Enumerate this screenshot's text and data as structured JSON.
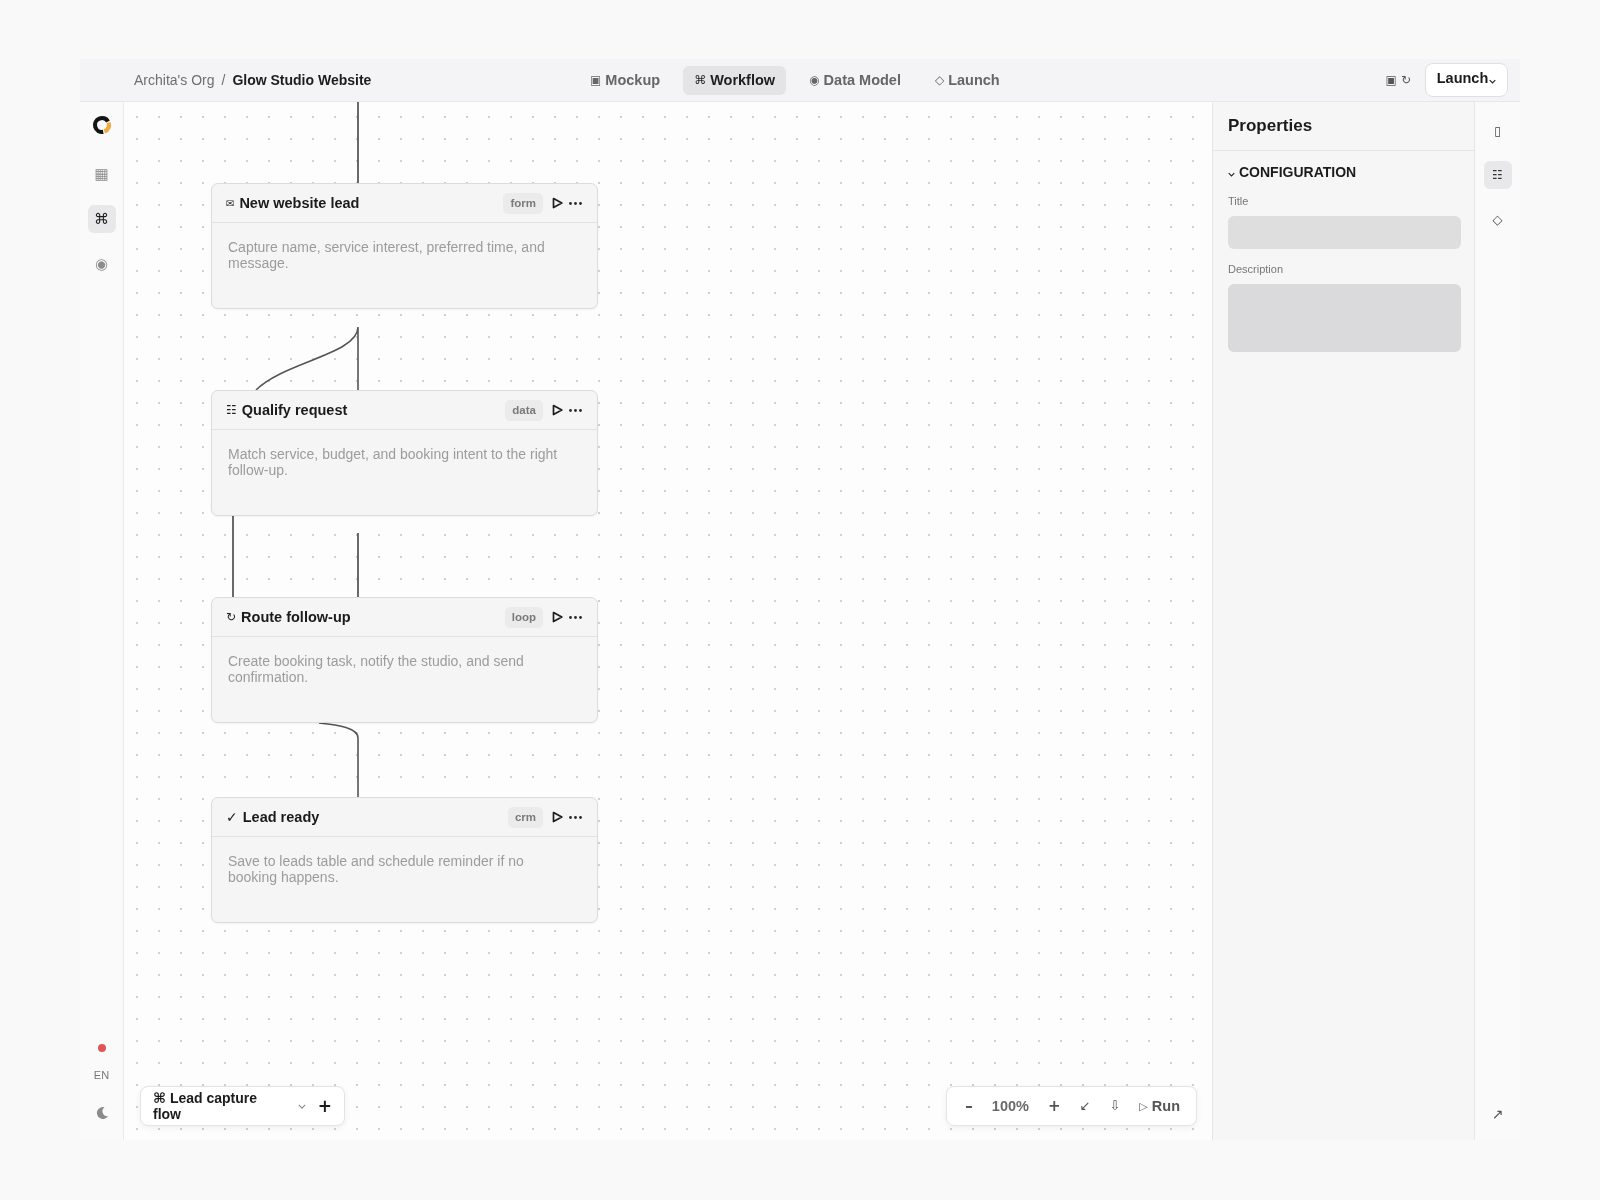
{
  "header": {
    "breadcrumb": {
      "org": "Archita's Org",
      "separator": "/",
      "project": "Glow Studio Website"
    },
    "tabs": [
      {
        "icon": "▣",
        "label": "Mockup",
        "selected": false
      },
      {
        "icon": "⌘",
        "label": "Workflow",
        "selected": true
      },
      {
        "icon": "◉",
        "label": "Data Model",
        "selected": false
      },
      {
        "icon": "◇",
        "label": "Launch",
        "selected": false
      }
    ],
    "tools": [
      "▣",
      "↻"
    ],
    "launch_button": {
      "label": "Launch"
    }
  },
  "left_rail": {
    "items": [
      {
        "icon": "▦",
        "selected": false
      },
      {
        "icon": "⌘",
        "selected": true
      },
      {
        "icon": "◉",
        "selected": false
      }
    ],
    "language": "EN"
  },
  "workflow": {
    "nodes": [
      {
        "icon": "✉",
        "title": "New website lead",
        "tag": "form",
        "description": "Capture name, service interest, preferred time, and message."
      },
      {
        "icon": "☷",
        "title": "Qualify request",
        "tag": "data",
        "description": "Match service, budget, and booking intent to the right follow-up."
      },
      {
        "icon": "↻",
        "title": "Route follow-up",
        "tag": "loop",
        "description": "Create booking task, notify the studio, and send confirmation."
      },
      {
        "icon": "✓",
        "title": "Lead ready",
        "tag": "crm",
        "description": "Save to leads table and schedule reminder if no booking happens."
      }
    ]
  },
  "flow_selector": {
    "name": "⌘ Lead capture flow",
    "add": "+"
  },
  "zoom_bar": {
    "zoom_out": "–",
    "zoom_level": "100%",
    "zoom_in": "+",
    "fit": "↙",
    "download": "⇩",
    "run": {
      "icon": "▷",
      "label": "Run"
    }
  },
  "properties": {
    "title": "Properties",
    "section": {
      "title": "CONFIGURATION",
      "expanded": true,
      "fields": [
        {
          "kind": "input",
          "label": "Title"
        },
        {
          "kind": "textarea",
          "label": "Description"
        }
      ]
    }
  },
  "right_rail": {
    "items": [
      {
        "icon": "▯",
        "selected": false
      },
      {
        "icon": "☷",
        "selected": true
      },
      {
        "icon": "◇",
        "selected": false
      }
    ],
    "corner": "↗"
  }
}
